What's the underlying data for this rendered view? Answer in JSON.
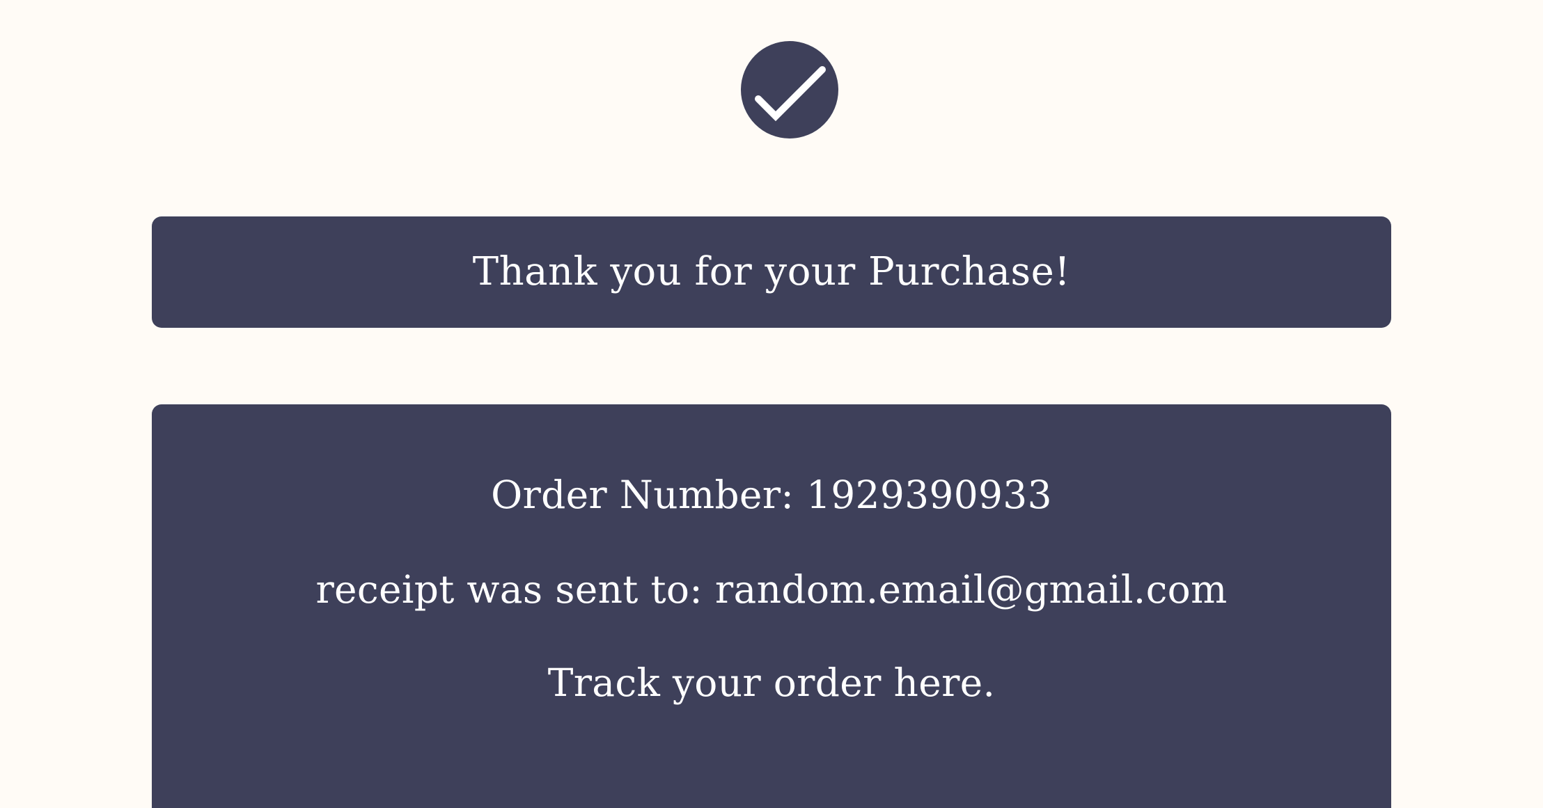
{
  "success_icon": "check-circle-icon",
  "colors": {
    "background": "#fffbf6",
    "panel": "#3e405a",
    "text": "#ffffff"
  },
  "banner": {
    "title": "Thank you for your Purchase!"
  },
  "details": {
    "order_number_text": "Order Number: 1929390933",
    "receipt_text": "receipt was sent to: random.email@gmail.com",
    "track_link_text": "Track your order here."
  }
}
